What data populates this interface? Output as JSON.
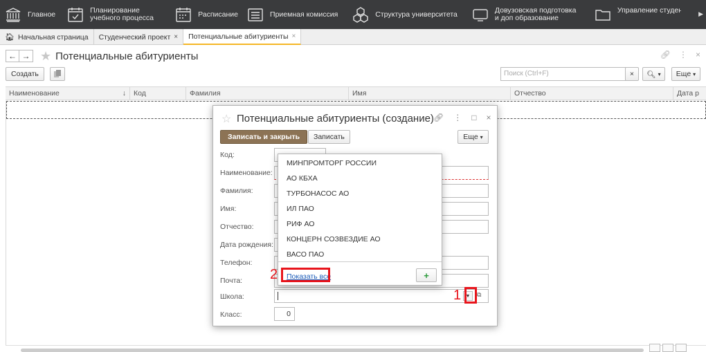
{
  "nav": {
    "items": [
      {
        "label": "Главное",
        "icon": "building-columns-icon"
      },
      {
        "label": "Планирование учебного процесса",
        "icon": "calendar-check-icon"
      },
      {
        "label": "Расписание",
        "icon": "calendar-grid-icon"
      },
      {
        "label": "Приемная комиссия",
        "icon": "list-icon"
      },
      {
        "label": "Структура университета",
        "icon": "cubes-icon"
      },
      {
        "label": "Довузовская подготовка и доп образование",
        "icon": "monitor-icon"
      },
      {
        "label": "Управление студенческим составом",
        "icon": "folder-icon"
      }
    ]
  },
  "tabs": [
    {
      "label": "Начальная страница"
    },
    {
      "label": "Студенческий проект",
      "close": "×"
    },
    {
      "label": "Потенциальные абитуриенты",
      "close": "×"
    }
  ],
  "page": {
    "title": "Потенциальные абитуриенты",
    "create_label": "Создать",
    "search_placeholder": "Поиск (Ctrl+F)",
    "search_clear": "×",
    "more_label": "Еще"
  },
  "table": {
    "columns": [
      "Наименование",
      "Код",
      "Фамилия",
      "Имя",
      "Отчество",
      "Дата р"
    ],
    "sort_indicator": "↓"
  },
  "modal": {
    "title": "Потенциальные абитуриенты (создание)",
    "save_close_label": "Записать и закрыть",
    "save_label": "Записать",
    "more_label": "Еще",
    "fields": {
      "code": "Код:",
      "name": "Наименование:",
      "surname": "Фамилия:",
      "firstname": "Имя:",
      "patronymic": "Отчество:",
      "birthdate": "Дата рождения:",
      "phone": "Телефон:",
      "email": "Почта:",
      "school": "Школа:",
      "grade": "Класс:"
    },
    "grade_value": "0"
  },
  "dropdown": {
    "items": [
      "МИНПРОМТОРГ РОССИИ",
      "АО КБХА",
      "ТУРБОНАСОС АО",
      "ИЛ ПАО",
      "РИФ АО",
      "КОНЦЕРН СОЗВЕЗДИЕ АО",
      "ВАСО ПАО"
    ],
    "show_all_label": "Показать все",
    "add_label": "+"
  },
  "annotations": {
    "mark1": "1",
    "mark2": "2",
    "color": "#e8141b"
  }
}
